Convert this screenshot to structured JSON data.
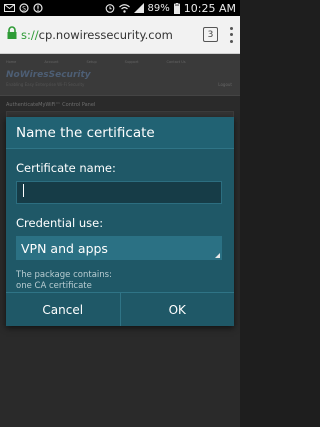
{
  "status_bar": {
    "battery": "89%",
    "time": "10:25 AM"
  },
  "browser": {
    "url_scheme": "s://",
    "url_host": "cp.nowiressecurity.com",
    "tab_count": "3"
  },
  "page": {
    "logo": "NoWiresSecurity",
    "tagline": "Enabling Easy Enterprise Wi-Fi Security",
    "nav_items": [
      "Home",
      "Account",
      "Setup",
      "Support",
      "Contact Us"
    ],
    "logout": "Logout",
    "panel_title": "AuthenticateMyWiFi™ Control Panel"
  },
  "dialog": {
    "title": "Name the certificate",
    "name_label": "Certificate name:",
    "name_value": "",
    "credential_label": "Credential use:",
    "credential_value": "VPN and apps",
    "info_line1": "The package contains:",
    "info_line2": "one CA certificate",
    "cancel_label": "Cancel",
    "ok_label": "OK"
  },
  "colors": {
    "dialog_bg": "#1f5867",
    "accent": "#2b7184",
    "secure_green": "#2e9b36"
  },
  "icons": {
    "status_left": [
      "mail-icon",
      "skype-icon",
      "alert-icon"
    ],
    "status_right": [
      "alarm-icon",
      "wifi-icon",
      "signal-icon",
      "battery-icon"
    ]
  }
}
